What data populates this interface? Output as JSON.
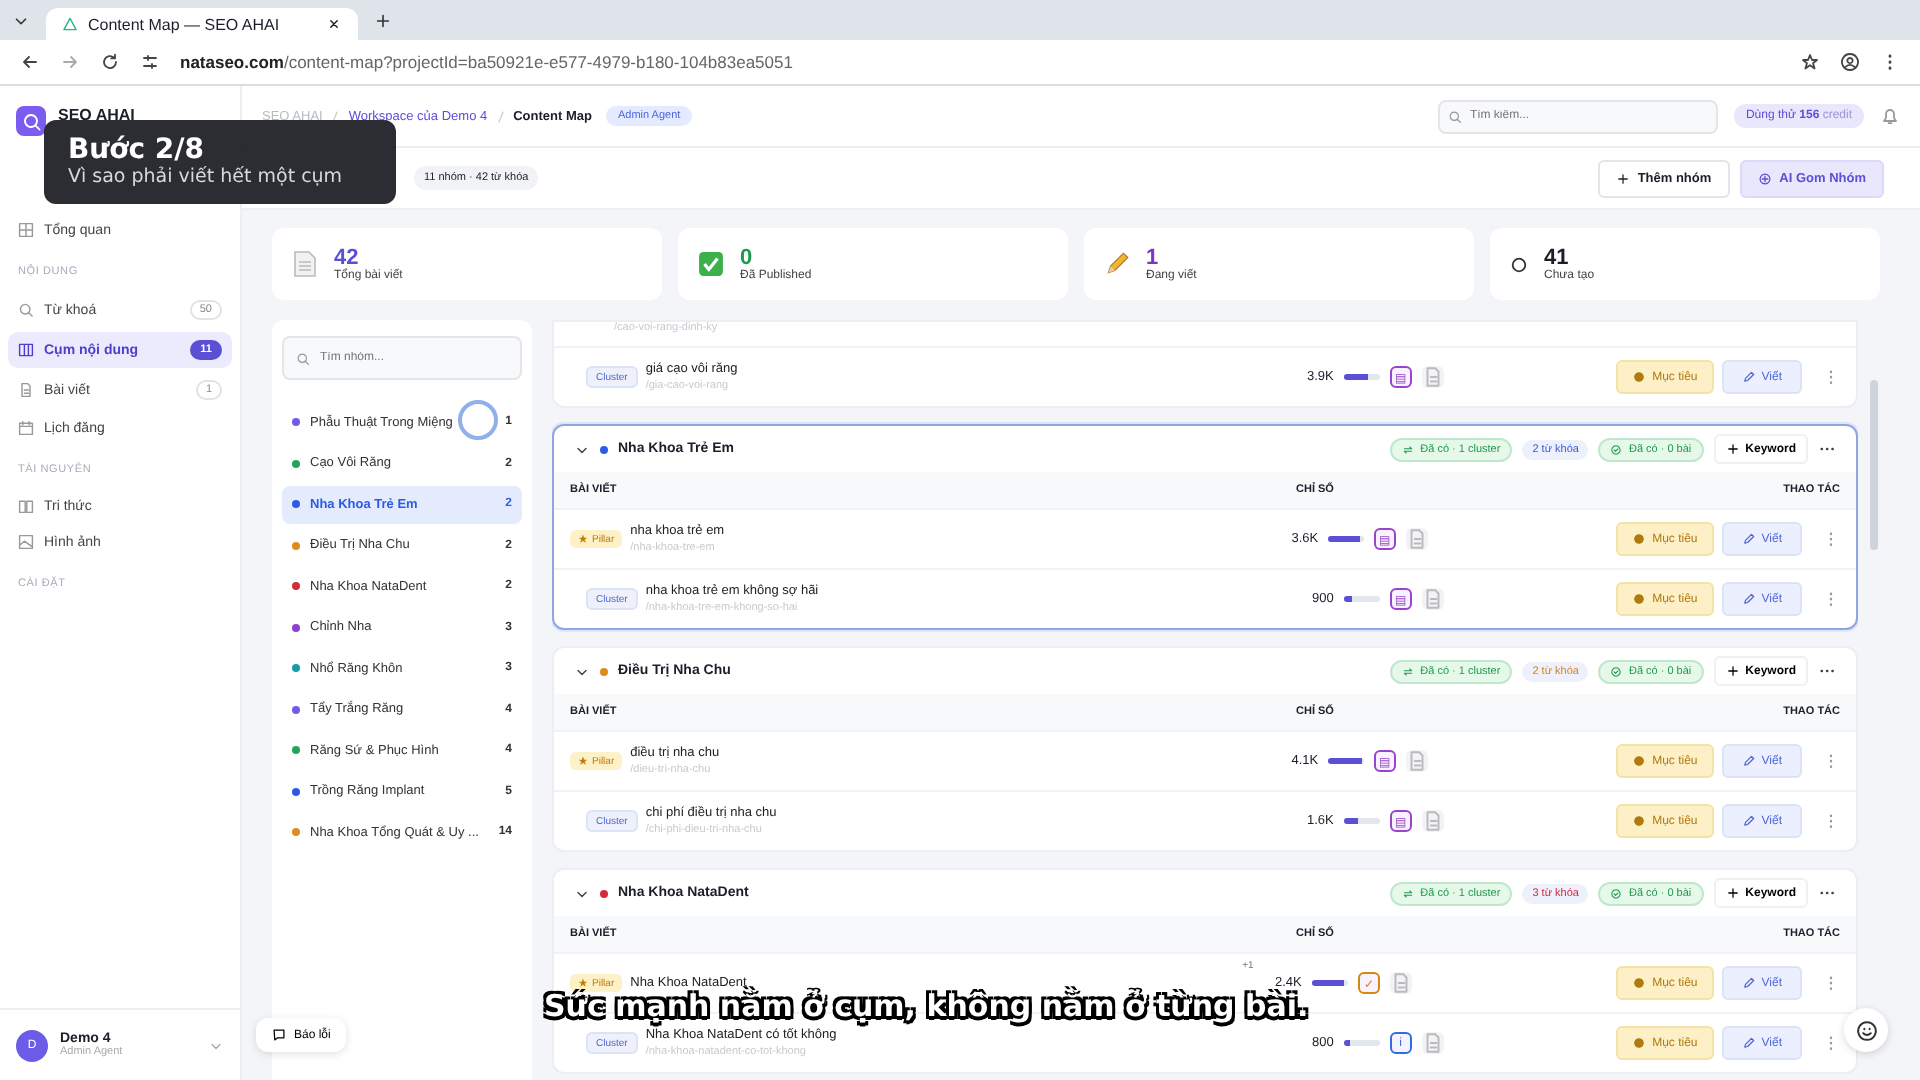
{
  "browser": {
    "tab_title": "Content Map — SEO AHAI",
    "url_host": "nataseo.com",
    "url_path": "/content-map?projectId=ba50921e-e577-4979-b180-104b83ea5051"
  },
  "tour": {
    "title": "Bước 2/8",
    "text": "Vì sao phải viết hết một cụm"
  },
  "caption": "Sức mạnh nằm ở cụm, không nằm ở từng bài.",
  "sidebar": {
    "brand": "SEO AHAI",
    "sections": [
      {
        "items": [
          {
            "label": "Tổng quan",
            "selected": false
          }
        ]
      },
      {
        "heading": "NỘI DUNG",
        "items": [
          {
            "label": "Từ khoá",
            "count": "50",
            "selected": false
          },
          {
            "label": "Cụm nội dung",
            "count": "11",
            "selected": true
          },
          {
            "label": "Bài viết",
            "count": "1",
            "selected": false
          },
          {
            "label": "Lịch đăng",
            "selected": false
          }
        ]
      },
      {
        "heading": "TÀI NGUYÊN",
        "items": [
          {
            "label": "Tri thức",
            "selected": false
          },
          {
            "label": "Hình ảnh",
            "selected": false
          }
        ]
      },
      {
        "heading": "CÀI ĐẶT"
      }
    ],
    "user": {
      "initial": "D",
      "name": "Demo 4",
      "role": "Admin Agent"
    }
  },
  "header": {
    "breadcrumb": [
      "SEO AHAI",
      "Workspace của Demo 4",
      "Content Map"
    ],
    "role_badge": "Admin Agent",
    "search": {
      "placeholder": "Tìm kiếm..."
    },
    "plan": "Dùng thử",
    "credits": "156",
    "credit_unit": "credit"
  },
  "toolbar": {
    "summary": "11 nhóm · 42 từ khóa",
    "buttons": [
      {
        "label": "Thêm nhóm",
        "kind": "add"
      },
      {
        "label": "AI Gom Nhóm",
        "kind": "ai"
      }
    ]
  },
  "stats": [
    {
      "value": "42",
      "label": "Tổng bài viết",
      "kind": "doc",
      "color": "#5b4fd6"
    },
    {
      "value": "0",
      "label": "Đã Published",
      "kind": "check",
      "color": "#1f9a4a"
    },
    {
      "value": "1",
      "label": "Đang viết",
      "kind": "pencil",
      "color": "#7a35c9"
    },
    {
      "value": "41",
      "label": "Chưa tạo",
      "kind": "circle",
      "color": "#1b1f2a"
    }
  ],
  "group_list": {
    "search": {
      "placeholder": "Tìm nhóm..."
    },
    "items": [
      {
        "name": "Phẫu Thuật Trong Miệng",
        "count": "1",
        "color": "#6c5ce7",
        "selected": false
      },
      {
        "name": "Cạo Vôi Răng",
        "count": "2",
        "color": "#22a45a",
        "selected": false
      },
      {
        "name": "Nha Khoa Trẻ Em",
        "count": "2",
        "color": "#2d5be3",
        "selected": true
      },
      {
        "name": "Điều Trị Nha Chu",
        "count": "2",
        "color": "#e08a1e",
        "selected": false
      },
      {
        "name": "Nha Khoa NataDent",
        "count": "2",
        "color": "#d42a3a",
        "selected": false
      },
      {
        "name": "Chỉnh Nha",
        "count": "3",
        "color": "#8e3fd6",
        "selected": false
      },
      {
        "name": "Nhổ Răng Khôn",
        "count": "3",
        "color": "#1a9aa8",
        "selected": false
      },
      {
        "name": "Tẩy Trắng Răng",
        "count": "4",
        "color": "#6c5ce7",
        "selected": false
      },
      {
        "name": "Răng Sứ & Phục Hình",
        "count": "4",
        "color": "#22a45a",
        "selected": false
      },
      {
        "name": "Trồng Răng Implant",
        "count": "5",
        "color": "#2d5be3",
        "selected": false
      },
      {
        "name": "Nha Khoa Tổng Quát & Uy ...",
        "count": "14",
        "color": "#e08a1e",
        "selected": false
      }
    ]
  },
  "report_button": "Báo lỗi",
  "groups": [
    {
      "selected": false,
      "rows": [
        {
          "kind": "cut",
          "slug": "/cao-voi-rang-dinh-ky"
        },
        {
          "kind": "cluster",
          "type_label": "Cluster",
          "title": "giá cạo vôi răng",
          "slug": "/gia-cao-voi-rang",
          "reading": "3.9K",
          "level": 0.65,
          "status_icon": "▤",
          "color": "#9a44c9",
          "goal_label": "Mục tiêu",
          "write_label": "Viết"
        }
      ]
    },
    {
      "name": "Nha Khoa Trẻ Em",
      "color": "#2d5be3",
      "expanded": true,
      "selected": true,
      "cluster_badge": "Đã có · 1 cluster",
      "keyword_badge": "2 từ khóa",
      "article_badge": "Đã có · 0 bài",
      "add_label": "Keyword",
      "columns": [
        "BÀI VIẾT",
        "CHỈ SỐ",
        "THAO TÁC"
      ],
      "rows": [
        {
          "kind": "pillar",
          "type_label": "Pillar",
          "title": "nha khoa trẻ em",
          "slug": "/nha-khoa-tre-em",
          "reading": "3.6K",
          "level": 0.9,
          "status_icon": "▤",
          "color": "#9a44c9",
          "goal_label": "Mục tiêu",
          "write_label": "Viết"
        },
        {
          "kind": "cluster",
          "type_label": "Cluster",
          "title": "nha khoa trẻ em không sợ hãi",
          "slug": "/nha-khoa-tre-em-khong-so-hai",
          "reading": "900",
          "level": 0.25,
          "status_icon": "▤",
          "color": "#9a44c9",
          "goal_label": "Mục tiêu",
          "write_label": "Viết"
        }
      ]
    },
    {
      "name": "Điều Trị Nha Chu",
      "color": "#e08a1e",
      "expanded": true,
      "selected": false,
      "cluster_badge": "Đã có · 1 cluster",
      "keyword_badge": "2 từ khóa",
      "article_badge": "Đã có · 0 bài",
      "add_label": "Keyword",
      "columns": [
        "BÀI VIẾT",
        "CHỈ SỐ",
        "THAO TÁC"
      ],
      "rows": [
        {
          "kind": "pillar",
          "type_label": "Pillar",
          "title": "điều trị nha chu",
          "slug": "/dieu-tri-nha-chu",
          "reading": "4.1K",
          "level": 0.95,
          "status_icon": "▤",
          "color": "#9a44c9",
          "goal_label": "Mục tiêu",
          "write_label": "Viết"
        },
        {
          "kind": "cluster",
          "type_label": "Cluster",
          "title": "chi phí điều trị nha chu",
          "slug": "/chi-phi-dieu-tri-nha-chu",
          "reading": "1.6K",
          "level": 0.4,
          "status_icon": "▤",
          "color": "#9a44c9",
          "goal_label": "Mục tiêu",
          "write_label": "Viết"
        }
      ]
    },
    {
      "name": "Nha Khoa NataDent",
      "color": "#d42a3a",
      "expanded": true,
      "selected": false,
      "cluster_badge": "Đã có · 1 cluster",
      "keyword_badge": "3 từ khóa",
      "article_badge": "Đã có · 0 bài",
      "add_label": "Keyword",
      "columns": [
        "BÀI VIẾT",
        "CHỈ SỐ",
        "THAO TÁC"
      ],
      "rows": [
        {
          "kind": "pillar",
          "type_label": "Pillar",
          "title": "Nha Khoa NataDent",
          "extra": "+1",
          "reading": "2.4K",
          "level": 0.9,
          "status_icon": "✓",
          "color": "#d08a10",
          "goal_label": "Mục tiêu",
          "write_label": "Viết"
        },
        {
          "kind": "cluster",
          "type_label": "Cluster",
          "title": "Nha Khoa NataDent có tốt không",
          "slug": "/nha-khoa-natadent-co-tot-khong",
          "reading": "800",
          "level": 0.2,
          "status_icon": "i",
          "color": "#2d6fe3",
          "goal_label": "Mục tiêu",
          "write_label": "Viết"
        }
      ]
    }
  ]
}
